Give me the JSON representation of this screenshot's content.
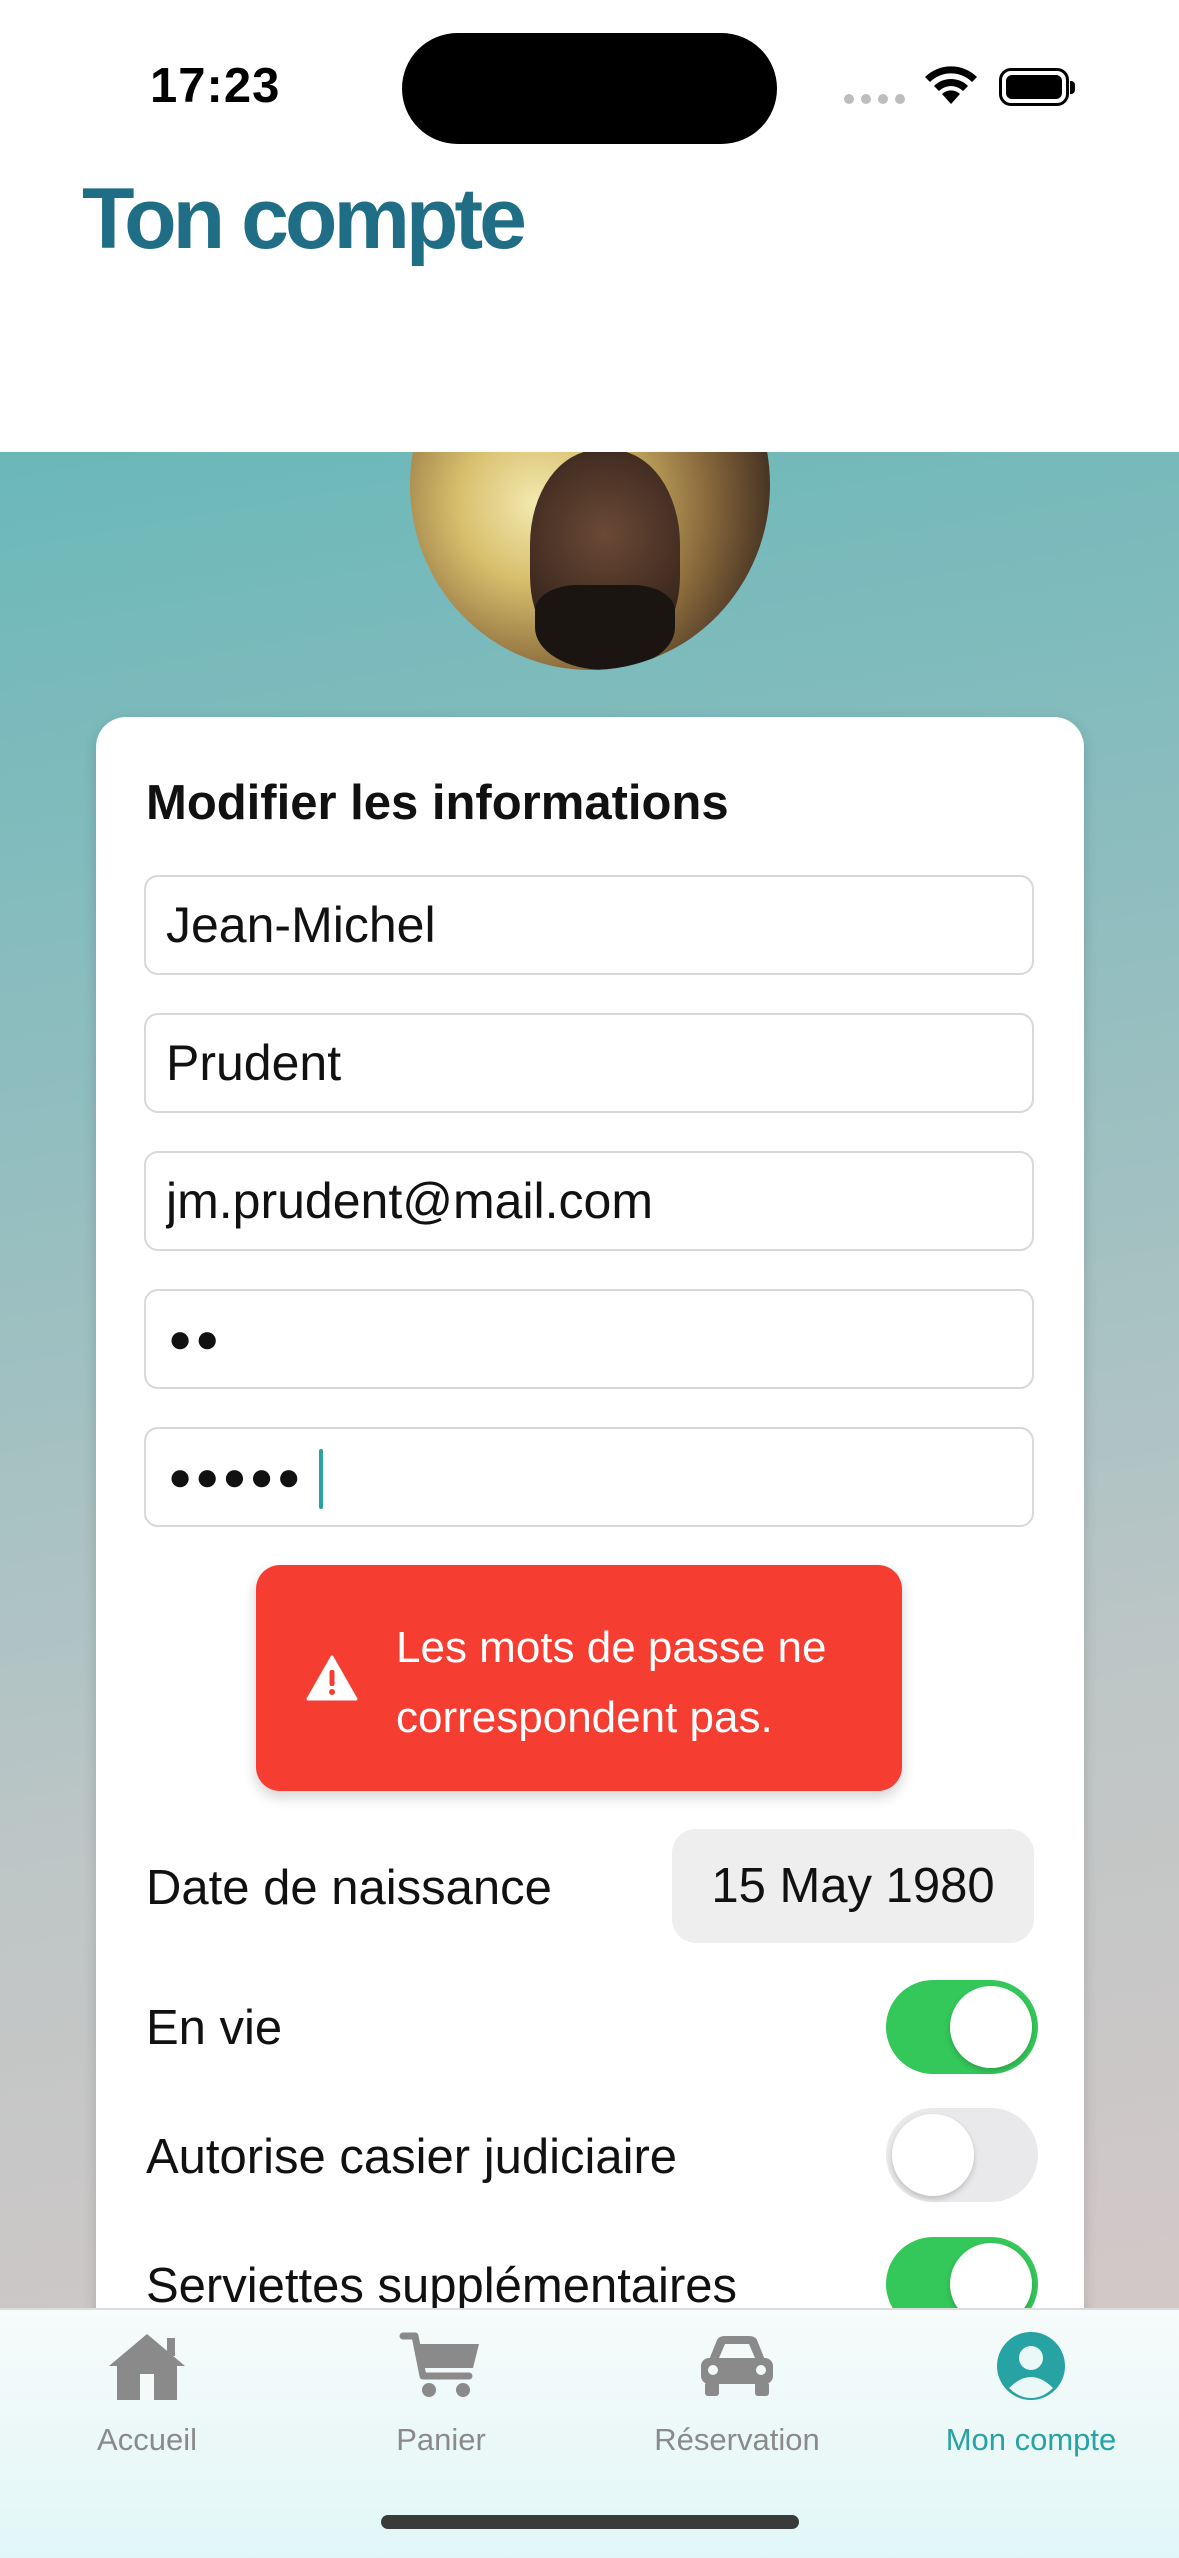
{
  "status_bar": {
    "time": "17:23"
  },
  "header": {
    "title": "Ton compte"
  },
  "form": {
    "title": "Modifier les informations",
    "first_name": "Jean-Michel",
    "last_name": "Prudent",
    "email": "jm.prudent@mail.com",
    "password_dots": "●●",
    "confirm_password_dots": "●●●●●"
  },
  "toast": {
    "message": "Les mots de passe ne correspondent pas."
  },
  "birthdate": {
    "label": "Date de naissance",
    "value": "15 May 1980"
  },
  "toggles": [
    {
      "label": "En vie",
      "on": true
    },
    {
      "label": "Autorise casier judiciaire",
      "on": false
    },
    {
      "label": "Serviettes supplémentaires",
      "on": true
    }
  ],
  "tabbar": {
    "items": [
      {
        "label": "Accueil",
        "icon": "home-icon"
      },
      {
        "label": "Panier",
        "icon": "cart-icon"
      },
      {
        "label": "Réservation",
        "icon": "car-icon"
      },
      {
        "label": "Mon compte",
        "icon": "account-icon",
        "active": true
      }
    ]
  },
  "colors": {
    "accent": "#27a3a3",
    "title": "#1f6e86",
    "toast": "#f53d32",
    "toggle_on": "#34c759"
  }
}
